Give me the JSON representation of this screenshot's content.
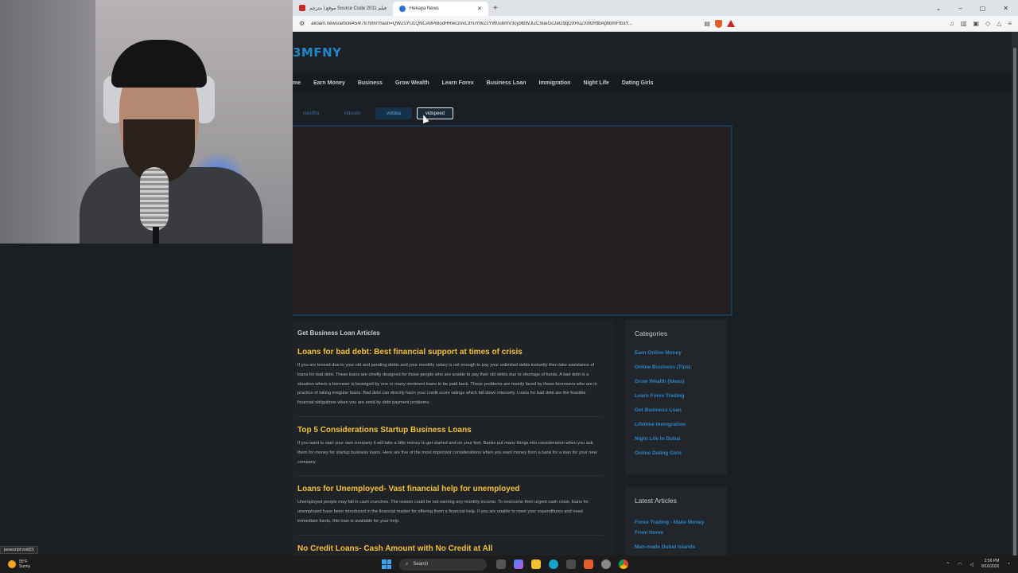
{
  "browser": {
    "tabs": [
      {
        "label": "موقع | مترجم Source Code 2011 فيلم",
        "active": false
      },
      {
        "label": "Hekaya News",
        "active": true
      }
    ],
    "new_tab": "+",
    "url": "akoam.news/article454/78.html?hash=QWZsYU1QNCA9PiBodHRwczovL3YuYWZsYW0ubmV3cy9lbWJlZC9ueGc2eG9qOXRuZXMzRtbAphbmFtb3Y...",
    "window_controls": [
      "⌄",
      "–",
      "▢",
      "✕"
    ]
  },
  "site": {
    "logo": "3MFNY",
    "menu": [
      "me",
      "Earn Money",
      "Business",
      "Grow Wealth",
      "Learn Forex",
      "Business Loan",
      "Immigration",
      "Night Life",
      "Dating Girls"
    ],
    "servers": [
      {
        "label": "vidsiffra",
        "style": "plain"
      },
      {
        "label": "vidsoon",
        "style": "plain"
      },
      {
        "label": "vidoba",
        "style": "filled"
      },
      {
        "label": "vidspeed",
        "style": "active"
      }
    ],
    "articles_section_title": "Get Business Loan Articles",
    "articles": [
      {
        "title": "Loans for bad debt: Best financial support at times of crisis",
        "body": "If you are tensed due to your old and pending debts and your monthly salary is not enough to pay your unlimited debts instantly then take assistance of loans for bad debt. These loans are chiefly designed for those people who are unable to pay their old debts due to shortage of funds. A bad debt is a situation where a borrower is besieged by one or many imminent loans to be paid back. These problems are mainly faced by those borrowers who are in practice of taking irregular loans. Bad debt can directly harm your credit score ratings which fall down intensely. Loans for bad debt are the feasible financial obligations when you are amid by debt payment problems."
      },
      {
        "title": "Top 5 Considerations Startup Business Loans",
        "body": "If you want to start your own company it will take a little money to get started and on your feet. Banks put many things into consideration when you ask them for money for startup business loans. Here are five of the most important considerations when you want money from a bank for a loan for your new company."
      },
      {
        "title": "Loans for Unemployed- Vast financial help for unemployed",
        "body": "Unemployed people may fall in cash crunches. The reason could be not earning any monthly income. To overcome their urgent cash crisis, loans for unemployed have been introduced in the financial market for offering them a financial help. If you are unable to meet your expenditures and need immediate funds, this loan is available for your help."
      },
      {
        "title": "No Credit Loans- Cash Amount with No Credit at All",
        "body": ""
      }
    ],
    "categories_title": "Categories",
    "categories": [
      "Earn Online Money",
      "Online Business (Tips)",
      "Grow Wealth (Ideas)",
      "Learn Forex Trading",
      "Get Business Loan",
      "Lifetime Immigration",
      "Night Life In Dubai",
      "Online Dating Girls"
    ],
    "latest_title": "Latest Articles",
    "latest": [
      "Forex Trading - Make Money From Home",
      "Man-made Dubai Islands"
    ]
  },
  "status_text": "javascript:void(0)",
  "taskbar": {
    "temp": "95°F",
    "condition": "Sunny",
    "search_placeholder": "Search",
    "time": "2:56 PM",
    "date": "8/16/2026"
  },
  "colors": {
    "accent_blue": "#1e88c9",
    "article_title": "#f2c230",
    "link_blue": "#2d84c4"
  }
}
